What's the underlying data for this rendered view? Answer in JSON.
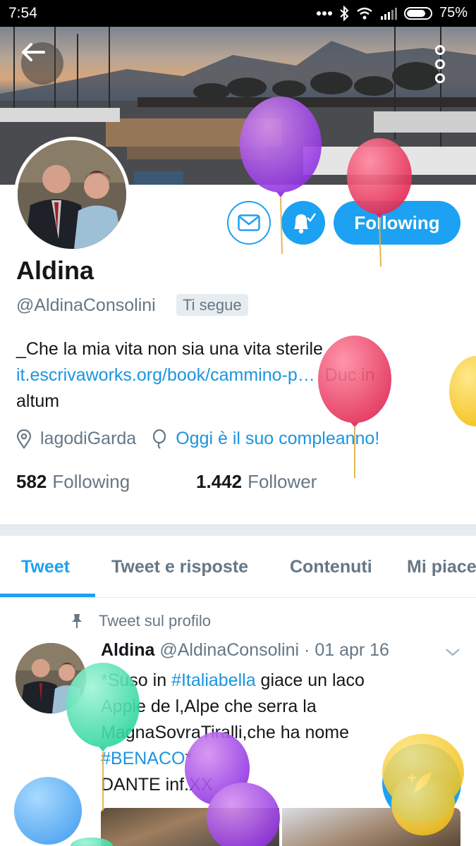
{
  "status_bar": {
    "time": "7:54",
    "battery": "75%"
  },
  "profile": {
    "name": "Aldina",
    "handle": "@AldinaConsolini",
    "follows_you": "Ti segue",
    "bio_text": "_Che la mia vita non sia una vita sterile",
    "bio_link": "it.escrivaworks.org/book/cammino-p…",
    "bio_tail_1": "Duc in",
    "bio_tail_2": "altum",
    "location": "lagodiGarda",
    "birthday": "Oggi è il suo compleanno!",
    "following_count": "582",
    "following_label": "Following",
    "followers_count": "1.442",
    "followers_label": "Follower",
    "follow_button": "Following"
  },
  "tabs": [
    {
      "label": "Tweet",
      "active": true
    },
    {
      "label": "Tweet e risposte",
      "active": false
    },
    {
      "label": "Contenuti",
      "active": false
    },
    {
      "label": "Mi piace",
      "active": false
    }
  ],
  "pinned_label": "Tweet sul profilo",
  "tweet": {
    "author": "Aldina",
    "handle": "@AldinaConsolini",
    "separator": "·",
    "date": "01 apr 16",
    "line1_a": "*Suso in ",
    "line1_hashtag": "#Italiabella",
    "line1_b": " giace un laco",
    "line2": "Appie de l,Alpe che serra la",
    "line3": "MagnaSovraTiralli,che ha nome",
    "line4_hashtag": "#BENACO",
    "line4_b": "*",
    "line5": "DANTE inf.XX"
  },
  "colors": {
    "accent": "#1da1f2",
    "link": "#1b95e0",
    "muted": "#657786"
  }
}
